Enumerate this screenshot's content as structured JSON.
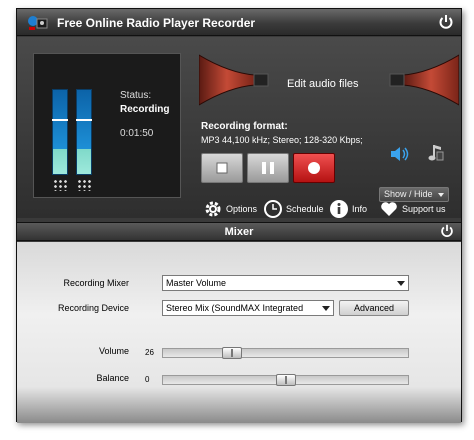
{
  "window": {
    "title": "Free Online Radio Player Recorder"
  },
  "status": {
    "label": "Status:",
    "value": "Recording",
    "time": "0:01:50"
  },
  "meters": {
    "left_level": 0.78,
    "right_level": 0.78,
    "left_peak": 0.62,
    "right_peak": 0.62
  },
  "edit": {
    "label": "Edit audio files"
  },
  "recording_format": {
    "label": "Recording format:",
    "value": "MP3 44,100 kHz; Stereo;  128-320 Kbps;"
  },
  "controls": {
    "stop": "stop-icon",
    "pause": "pause-icon",
    "record": "record-icon"
  },
  "show_hide": {
    "label": "Show / Hide"
  },
  "options": {
    "options_label": "Options",
    "schedule_label": "Schedule",
    "info_label": "Info",
    "support_label": "Support us"
  },
  "mixer": {
    "title": "Mixer",
    "recording_mixer_label": "Recording Mixer",
    "recording_mixer_value": "Master Volume",
    "recording_device_label": "Recording Device",
    "recording_device_value": "Stereo Mix (SoundMAX Integrated",
    "advanced_label": "Advanced",
    "volume_label": "Volume",
    "volume_value": "26",
    "volume_level": 0.26,
    "balance_label": "Balance",
    "balance_value": "0",
    "balance_level": 0.5
  },
  "colors": {
    "accent_blue": "#1d8fd6",
    "record_red": "#d92020",
    "horn_red": "#b5392a"
  }
}
